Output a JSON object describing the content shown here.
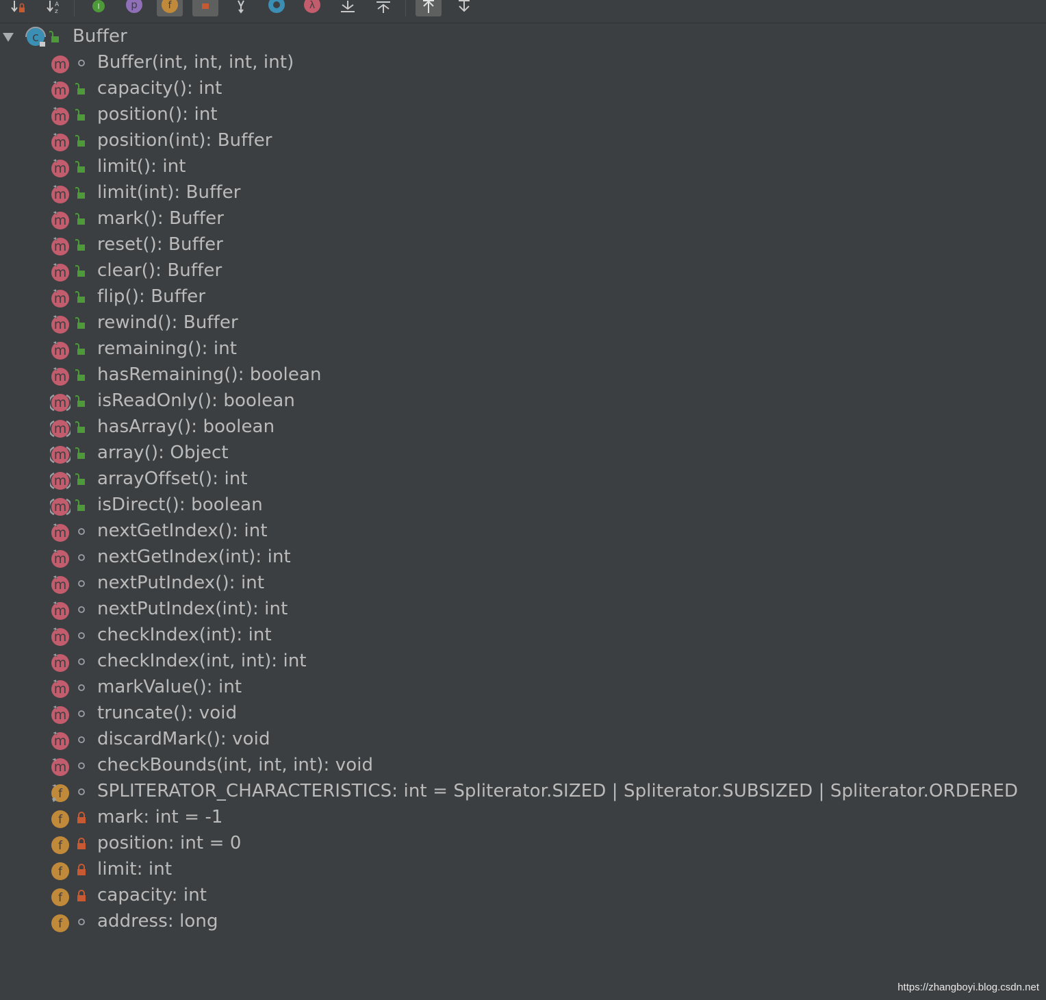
{
  "toolbar": {
    "buttons": [
      {
        "name": "sort-by-visibility-button",
        "icon": "sort-visibility-icon",
        "selected": false
      },
      {
        "name": "sort-alphabetically-button",
        "icon": "sort-alpha-icon",
        "letters": "AZ",
        "selected": false
      },
      {
        "name": "show-interfaces-button",
        "icon": "interface-icon",
        "letter": "I",
        "selected": false
      },
      {
        "name": "show-properties-button",
        "icon": "property-icon",
        "letter": "p",
        "selected": false
      },
      {
        "name": "show-fields-button",
        "icon": "field-icon",
        "letter": "f",
        "selected": true
      },
      {
        "name": "show-non-public-button",
        "icon": "lock-icon",
        "selected": true
      },
      {
        "name": "show-inherited-button",
        "icon": "inherited-icon",
        "selected": false
      },
      {
        "name": "show-anonymous-button",
        "icon": "anonymous-class-icon",
        "selected": false
      },
      {
        "name": "show-lambdas-button",
        "icon": "lambda-icon",
        "letter": "λ",
        "selected": false
      },
      {
        "name": "expand-all-button",
        "icon": "expand-all-icon",
        "selected": false
      },
      {
        "name": "collapse-all-button",
        "icon": "collapse-all-icon",
        "selected": false
      },
      {
        "name": "autoscroll-to-source-button",
        "icon": "autoscroll-to-source-icon",
        "selected": true
      },
      {
        "name": "autoscroll-from-source-button",
        "icon": "autoscroll-from-source-icon",
        "selected": false
      }
    ]
  },
  "tree": {
    "root": {
      "label": "Buffer",
      "kind": "class",
      "visibility": "public",
      "expanded": true
    },
    "members": [
      {
        "label": "Buffer(int, int, int, int)",
        "kind": "method",
        "visibility": "package"
      },
      {
        "label": "capacity(): int",
        "kind": "method",
        "visibility": "public",
        "modifier": "final"
      },
      {
        "label": "position(): int",
        "kind": "method",
        "visibility": "public",
        "modifier": "final"
      },
      {
        "label": "position(int): Buffer",
        "kind": "method",
        "visibility": "public",
        "modifier": "final"
      },
      {
        "label": "limit(): int",
        "kind": "method",
        "visibility": "public",
        "modifier": "final"
      },
      {
        "label": "limit(int): Buffer",
        "kind": "method",
        "visibility": "public",
        "modifier": "final"
      },
      {
        "label": "mark(): Buffer",
        "kind": "method",
        "visibility": "public",
        "modifier": "final"
      },
      {
        "label": "reset(): Buffer",
        "kind": "method",
        "visibility": "public",
        "modifier": "final"
      },
      {
        "label": "clear(): Buffer",
        "kind": "method",
        "visibility": "public",
        "modifier": "final"
      },
      {
        "label": "flip(): Buffer",
        "kind": "method",
        "visibility": "public",
        "modifier": "final"
      },
      {
        "label": "rewind(): Buffer",
        "kind": "method",
        "visibility": "public",
        "modifier": "final"
      },
      {
        "label": "remaining(): int",
        "kind": "method",
        "visibility": "public",
        "modifier": "final"
      },
      {
        "label": "hasRemaining(): boolean",
        "kind": "method",
        "visibility": "public",
        "modifier": "final"
      },
      {
        "label": "isReadOnly(): boolean",
        "kind": "method",
        "visibility": "public",
        "modifier": "abstract"
      },
      {
        "label": "hasArray(): boolean",
        "kind": "method",
        "visibility": "public",
        "modifier": "abstract"
      },
      {
        "label": "array(): Object",
        "kind": "method",
        "visibility": "public",
        "modifier": "abstract"
      },
      {
        "label": "arrayOffset(): int",
        "kind": "method",
        "visibility": "public",
        "modifier": "abstract"
      },
      {
        "label": "isDirect(): boolean",
        "kind": "method",
        "visibility": "public",
        "modifier": "abstract"
      },
      {
        "label": "nextGetIndex(): int",
        "kind": "method",
        "visibility": "package",
        "modifier": "final"
      },
      {
        "label": "nextGetIndex(int): int",
        "kind": "method",
        "visibility": "package",
        "modifier": "final"
      },
      {
        "label": "nextPutIndex(): int",
        "kind": "method",
        "visibility": "package",
        "modifier": "final"
      },
      {
        "label": "nextPutIndex(int): int",
        "kind": "method",
        "visibility": "package",
        "modifier": "final"
      },
      {
        "label": "checkIndex(int): int",
        "kind": "method",
        "visibility": "package",
        "modifier": "final"
      },
      {
        "label": "checkIndex(int, int): int",
        "kind": "method",
        "visibility": "package",
        "modifier": "final"
      },
      {
        "label": "markValue(): int",
        "kind": "method",
        "visibility": "package",
        "modifier": "final"
      },
      {
        "label": "truncate(): void",
        "kind": "method",
        "visibility": "package",
        "modifier": "final"
      },
      {
        "label": "discardMark(): void",
        "kind": "method",
        "visibility": "package",
        "modifier": "final"
      },
      {
        "label": "checkBounds(int, int, int): void",
        "kind": "method",
        "visibility": "package",
        "modifier": "static"
      },
      {
        "label": "SPLITERATOR_CHARACTERISTICS: int = Spliterator.SIZED | Spliterator.SUBSIZED | Spliterator.ORDERED",
        "kind": "field",
        "visibility": "package",
        "modifier": "static-final"
      },
      {
        "label": "mark: int = -1",
        "kind": "field",
        "visibility": "private"
      },
      {
        "label": "position: int = 0",
        "kind": "field",
        "visibility": "private"
      },
      {
        "label": "limit: int",
        "kind": "field",
        "visibility": "private"
      },
      {
        "label": "capacity: int",
        "kind": "field",
        "visibility": "private"
      },
      {
        "label": "address: long",
        "kind": "field",
        "visibility": "package"
      }
    ]
  },
  "colors": {
    "background": "#3c3f41",
    "text": "#bbbbbb",
    "method": "#c35c6c",
    "field": "#c08a3a",
    "class": "#3c8fb4",
    "public": "#4e9a3a",
    "private": "#c75a33"
  },
  "watermark": "https://zhangboyi.blog.csdn.net"
}
